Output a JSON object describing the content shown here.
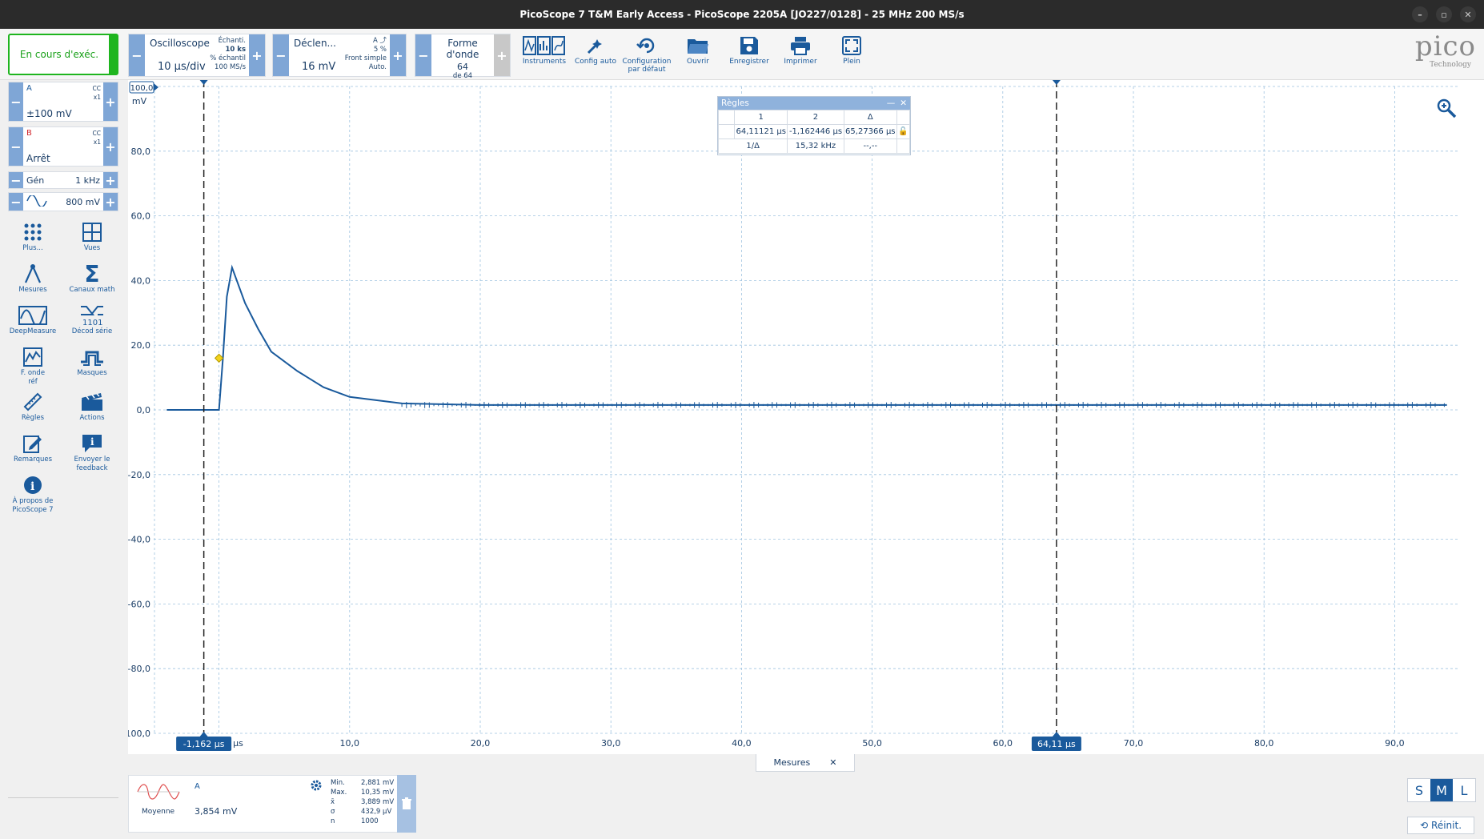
{
  "window": {
    "title": "PicoScope 7 T&M Early Access  - PicoScope 2205A [JO227/0128] - 25 MHz 200 MS/s"
  },
  "toolbar": {
    "run_status": "En cours d'exéc.",
    "scope": {
      "label": "Oscilloscope",
      "value": "10 µs/div",
      "samples_label": "Échanti.",
      "samples": "10 ks",
      "sample_rate_label": "% échantil",
      "sample_rate": "100 MS/s"
    },
    "trigger": {
      "label": "Déclen...",
      "value": "16 mV",
      "channel": "A",
      "percent": "5 %",
      "mode": "Front simple",
      "auto": "Auto."
    },
    "waveform": {
      "label": "Forme d'onde",
      "current": "64",
      "of": "de 64"
    },
    "buttons": [
      {
        "label": "Instruments",
        "icon": "instruments-icon"
      },
      {
        "label": "Config auto",
        "icon": "auto-setup-icon"
      },
      {
        "label": "Configuration par défaut",
        "icon": "default-setup-icon"
      },
      {
        "label": "Ouvrir",
        "icon": "folder-icon"
      },
      {
        "label": "Enregistrer",
        "icon": "save-icon"
      },
      {
        "label": "Imprimer",
        "icon": "print-icon"
      },
      {
        "label": "Plein",
        "icon": "fullscreen-icon"
      }
    ],
    "logo_main": "pico",
    "logo_sub": "Technology"
  },
  "channels": [
    {
      "name": "A",
      "coupling": "CC",
      "probe": "x1",
      "range": "±100 mV",
      "color": "#1a5a9c"
    },
    {
      "name": "B",
      "coupling": "CC",
      "probe": "x1",
      "range": "Arrêt",
      "color": "#d0242a"
    }
  ],
  "generator": {
    "label": "Gén",
    "freq": "1 kHz",
    "amplitude": "800 mV"
  },
  "side_tools": [
    {
      "label": "Plus...",
      "icon": "more-dots-icon"
    },
    {
      "label": "Vues",
      "icon": "views-grid-icon"
    },
    {
      "label": "Mesures",
      "icon": "measure-compass-icon"
    },
    {
      "label": "Canaux math",
      "icon": "sigma-icon"
    },
    {
      "label": "DeepMeasure",
      "icon": "deepmeasure-icon"
    },
    {
      "label": "Décod série",
      "icon": "serial-decode-icon"
    },
    {
      "label": "F. onde réf",
      "icon": "reference-waveform-icon"
    },
    {
      "label": "Masques",
      "icon": "masks-icon"
    },
    {
      "label": "Règles",
      "icon": "ruler-icon"
    },
    {
      "label": "Actions",
      "icon": "clapper-icon"
    },
    {
      "label": "Remarques",
      "icon": "notes-icon"
    },
    {
      "label": "Envoyer le feedback",
      "icon": "feedback-icon"
    },
    {
      "label": "À propos de PicoScope 7",
      "icon": "info-icon"
    }
  ],
  "plot": {
    "y_unit": "mV",
    "y_top_label": "100,0",
    "y_ticks": [
      "80,0",
      "60,0",
      "40,0",
      "20,0",
      "0,0",
      "-20,0",
      "-40,0",
      "-60,0",
      "-80,0",
      "-100,0"
    ],
    "x_ticks": [
      "10,0",
      "20,0",
      "30,0",
      "40,0",
      "50,0",
      "60,0",
      "70,0",
      "80,0",
      "90,0"
    ],
    "x_unit": "µs",
    "cursor1_label": "-1,162 µs",
    "cursor2_label": "64,11 µs",
    "trace_color": "#1a5a9c"
  },
  "rulers": {
    "title": "Règles",
    "col_headers": [
      "1",
      "2",
      "Δ"
    ],
    "row1": [
      "64,11121 µs",
      "-1,162446 µs",
      "65,27366 µs"
    ],
    "row2_label": "1/Δ",
    "row2": [
      "15,32 kHz",
      "--,--"
    ]
  },
  "chart_data": {
    "type": "line",
    "title": "",
    "xlabel": "µs",
    "ylabel": "mV",
    "xlim": [
      -5,
      95
    ],
    "ylim": [
      -100,
      100
    ],
    "grid": true,
    "series": [
      {
        "name": "A",
        "x": [
          -4,
          -1.2,
          0,
          0.3,
          0.6,
          1,
          2,
          3,
          4,
          6,
          8,
          10,
          14,
          20,
          30,
          40,
          50,
          60,
          70,
          80,
          90,
          94
        ],
        "y": [
          0,
          0,
          0,
          16,
          35,
          44,
          33,
          25,
          18,
          12,
          7,
          4,
          2,
          1.5,
          1.5,
          1.5,
          1.5,
          1.5,
          1.5,
          1.5,
          1.5,
          1.5
        ]
      }
    ],
    "cursors": [
      -1.162446,
      64.11121
    ]
  },
  "measurements": {
    "tab_label": "Mesures",
    "channel": "A",
    "stat": "Moyenne",
    "value": "3,854 mV",
    "stats": [
      {
        "k": "Min.",
        "v": "2,881 mV"
      },
      {
        "k": "Max.",
        "v": "10,35 mV"
      },
      {
        "k": "x̄",
        "v": "3,889 mV"
      },
      {
        "k": "σ",
        "v": "432,9 µV"
      },
      {
        "k": "n",
        "v": "1000"
      }
    ]
  },
  "size_buttons": [
    "S",
    "M",
    "L"
  ],
  "reset_label": "Réinit."
}
